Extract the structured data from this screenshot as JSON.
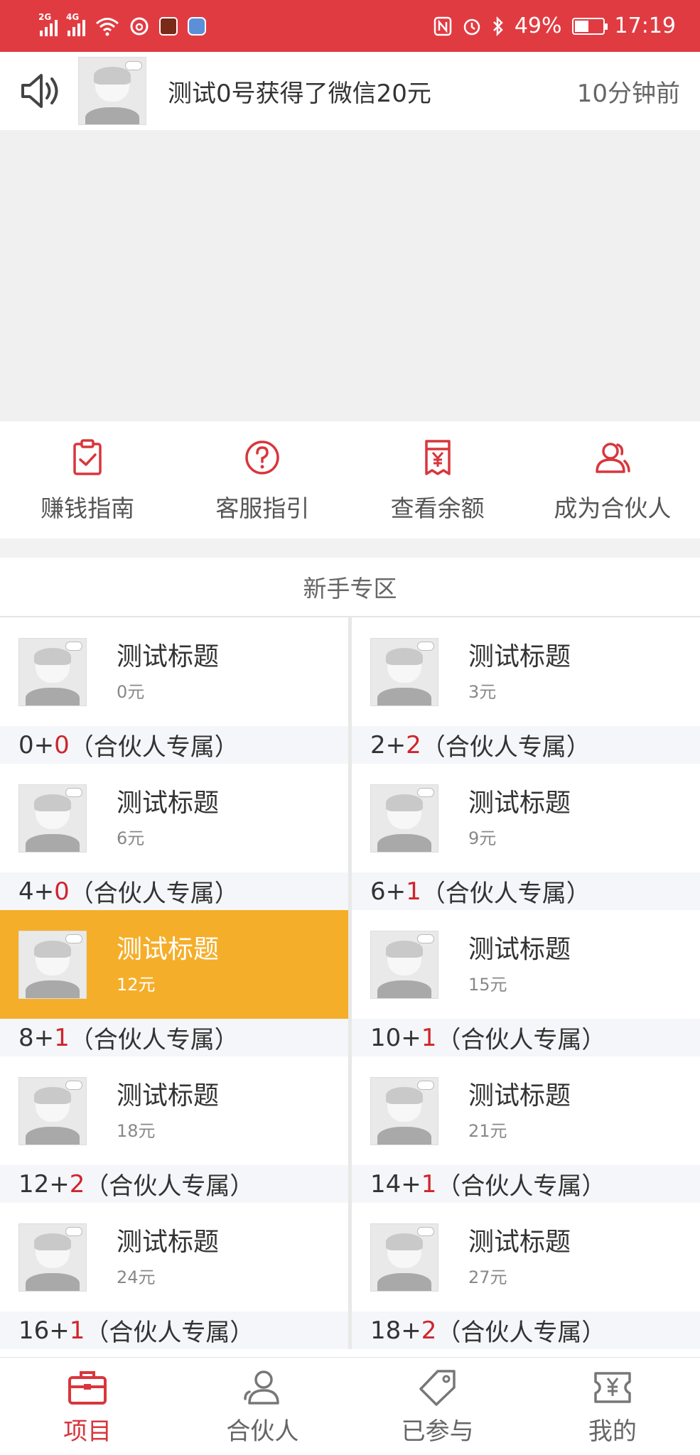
{
  "status_bar": {
    "network_1": "2G",
    "network_2": "4G",
    "battery": "49%",
    "battery_fraction": 0.49,
    "time": "17:19",
    "accent": "#e13b42"
  },
  "notice": {
    "text": "测试0号获得了微信20元",
    "time": "10分钟前"
  },
  "quick_menu": [
    {
      "label": "赚钱指南",
      "icon": "clipboard-check-icon"
    },
    {
      "label": "客服指引",
      "icon": "question-circle-icon"
    },
    {
      "label": "查看余额",
      "icon": "yen-receipt-icon"
    },
    {
      "label": "成为合伙人",
      "icon": "partner-user-icon"
    }
  ],
  "section": {
    "title": "新手专区",
    "items": [
      {
        "title": "测试标题",
        "price": "0元",
        "base": "0+",
        "bonus": "0",
        "suffix": "（合伙人专属）",
        "active": false
      },
      {
        "title": "测试标题",
        "price": "3元",
        "base": "2+",
        "bonus": "2",
        "suffix": "（合伙人专属）",
        "active": false
      },
      {
        "title": "测试标题",
        "price": "6元",
        "base": "4+",
        "bonus": "0",
        "suffix": "（合伙人专属）",
        "active": false
      },
      {
        "title": "测试标题",
        "price": "9元",
        "base": "6+",
        "bonus": "1",
        "suffix": "（合伙人专属）",
        "active": false
      },
      {
        "title": "测试标题",
        "price": "12元",
        "base": "8+",
        "bonus": "1",
        "suffix": "（合伙人专属）",
        "active": true
      },
      {
        "title": "测试标题",
        "price": "15元",
        "base": "10+",
        "bonus": "1",
        "suffix": "（合伙人专属）",
        "active": false
      },
      {
        "title": "测试标题",
        "price": "18元",
        "base": "12+",
        "bonus": "2",
        "suffix": "（合伙人专属）",
        "active": false
      },
      {
        "title": "测试标题",
        "price": "21元",
        "base": "14+",
        "bonus": "1",
        "suffix": "（合伙人专属）",
        "active": false
      },
      {
        "title": "测试标题",
        "price": "24元",
        "base": "16+",
        "bonus": "1",
        "suffix": "（合伙人专属）",
        "active": false
      },
      {
        "title": "测试标题",
        "price": "27元",
        "base": "18+",
        "bonus": "2",
        "suffix": "（合伙人专属）",
        "active": false
      }
    ]
  },
  "tabbar": [
    {
      "label": "项目",
      "icon": "briefcase-icon",
      "active": true
    },
    {
      "label": "合伙人",
      "icon": "person-icon",
      "active": false
    },
    {
      "label": "已参与",
      "icon": "tag-icon",
      "active": false
    },
    {
      "label": "我的",
      "icon": "ticket-yen-icon",
      "active": false
    }
  ],
  "colors": {
    "brand_red": "#d8363c",
    "highlight": "#f5ae2a",
    "bonus_red": "#d0242c"
  }
}
